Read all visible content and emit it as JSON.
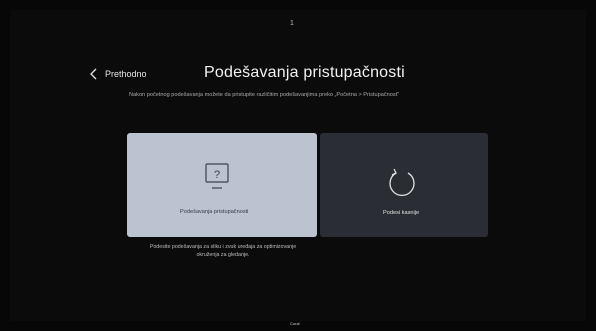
{
  "header": {
    "top_indicator": "1",
    "back_label": "Prethodno",
    "title": "Podešavanja pristupačnosti",
    "subtitle": "Nakon početnog podešavanja možete da pristupite različitim podešavanjima preko „Početna > Pristupačnost\""
  },
  "cards": {
    "accessibility": {
      "icon": "monitor-question-icon",
      "label": "Podešavanja pristupačnosti",
      "description": "Podesite podešavanja za sliku i zvuk uređaja za optimizovanje okruženja za gledanje."
    },
    "reset": {
      "icon": "refresh-icon",
      "label": "Podesi kasnije"
    }
  },
  "footer": {
    "brand_text": "Coral"
  },
  "colors": {
    "background": "#0b0b0c",
    "card_selected": "#bcc3d0",
    "card_unselected": "#2a2d34"
  }
}
